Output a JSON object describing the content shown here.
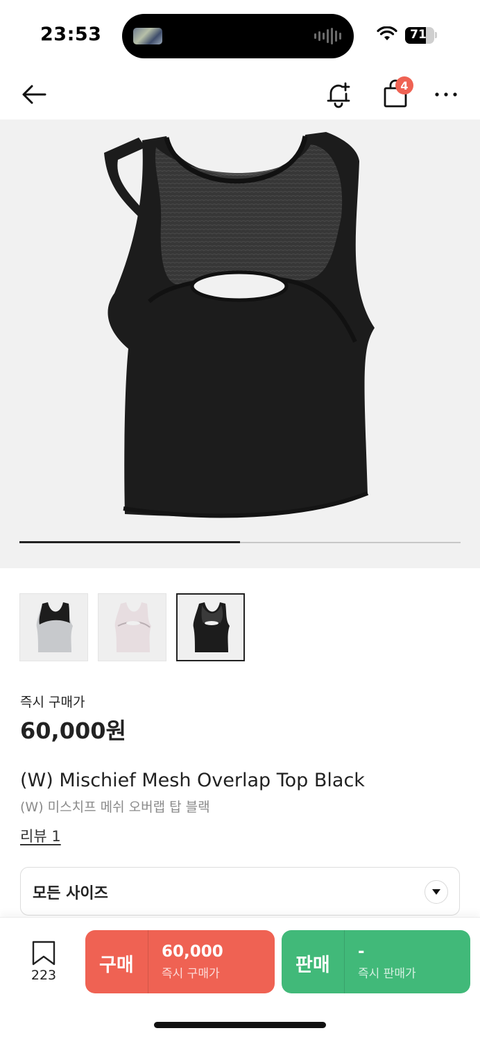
{
  "status_bar": {
    "time": "23:53",
    "battery_percent": "71",
    "battery_level": 0.71
  },
  "nav": {
    "back_icon": "arrow-left-icon",
    "alert_icon": "bell-plus-icon",
    "cart_icon": "shopping-bag-icon",
    "cart_count": "4",
    "more_icon": "ellipsis-icon"
  },
  "gallery": {
    "current_image": 3,
    "total_images": 3,
    "progress": 0.5,
    "thumbnails": [
      {
        "label": "grey-black",
        "selected": false
      },
      {
        "label": "pink",
        "selected": false
      },
      {
        "label": "black",
        "selected": true
      }
    ]
  },
  "product": {
    "price_label": "즉시 구매가",
    "price": "60,000원",
    "title": "(W) Mischief Mesh Overlap Top Black",
    "subtitle": "(W) 미스치프 메쉬 오버랩 탑 블랙",
    "review_link": "리뷰 1"
  },
  "size_select": {
    "label": "모든 사이즈"
  },
  "bottom_bar": {
    "bookmark_count": "223",
    "buy": {
      "label": "구매",
      "price": "60,000",
      "sub": "즉시 구매가"
    },
    "sell": {
      "label": "판매",
      "price": "-",
      "sub": "즉시 판매가"
    }
  },
  "colors": {
    "buy": "#ef6253",
    "sell": "#41b979",
    "badge": "#ef6253",
    "hero_bg": "#f1f1f1"
  }
}
